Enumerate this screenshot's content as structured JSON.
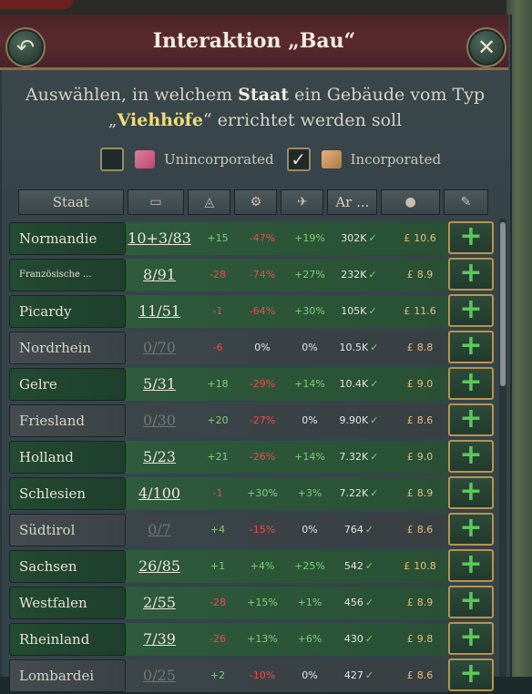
{
  "dialog": {
    "title": "Interaktion „Bau“",
    "back_icon": "undo-arrow-icon",
    "close_icon": "close-x-icon",
    "prompt_prefix": "Auswählen, in welchem ",
    "prompt_bold": "Staat",
    "prompt_middle": " ein Gebäude vom Typ",
    "prompt_open_quote": "„",
    "prompt_building": "Viehhöfe",
    "prompt_suffix": "“ errichtet werden soll"
  },
  "filters": {
    "unincorporated": {
      "label": "Unincorporated",
      "checked": false
    },
    "incorporated": {
      "label": "Incorporated",
      "checked": true
    }
  },
  "columns": {
    "state": "Staat",
    "buildings_icon": "building-levels-icon",
    "construction_icon": "construction-icon",
    "infrastructure_icon": "infrastructure-icon",
    "airport_icon": "airplane-icon",
    "arable": "Ar ...",
    "cost_icon": "bomb-cost-icon",
    "action_icon": "edit-icon"
  },
  "colors": {
    "positive": "#7fd07a",
    "negative": "#f04a4a",
    "accent_border": "#b8944c",
    "highlight": "#f0dd78"
  },
  "rows": [
    {
      "name": "Normandie",
      "levels": "10+3/83",
      "c1": "+15",
      "c2": "-47%",
      "c3": "+19%",
      "c4": "302K",
      "c5": "10.6",
      "dim": false
    },
    {
      "name": "Französische ...",
      "levels": "8/91",
      "c1": "-28",
      "c2": "-74%",
      "c3": "+27%",
      "c4": "232K",
      "c5": "8.9",
      "dim": false
    },
    {
      "name": "Picardy",
      "levels": "11/51",
      "c1": "-1",
      "c2": "-64%",
      "c3": "+30%",
      "c4": "105K",
      "c5": "11.6",
      "dim": false
    },
    {
      "name": "Nordrhein",
      "levels": "0/70",
      "c1": "-6",
      "c2": "0%",
      "c3": "0%",
      "c4": "10.5K",
      "c5": "8.8",
      "dim": true
    },
    {
      "name": "Gelre",
      "levels": "5/31",
      "c1": "+18",
      "c2": "-29%",
      "c3": "+14%",
      "c4": "10.4K",
      "c5": "9.0",
      "dim": false
    },
    {
      "name": "Friesland",
      "levels": "0/30",
      "c1": "+20",
      "c2": "-27%",
      "c3": "0%",
      "c4": "9.90K",
      "c5": "8.6",
      "dim": true
    },
    {
      "name": "Holland",
      "levels": "5/23",
      "c1": "+21",
      "c2": "-26%",
      "c3": "+14%",
      "c4": "7.32K",
      "c5": "9.0",
      "dim": false
    },
    {
      "name": "Schlesien",
      "levels": "4/100",
      "c1": "-1",
      "c2": "+30%",
      "c3": "+3%",
      "c4": "7.22K",
      "c5": "8.9",
      "dim": false
    },
    {
      "name": "Südtirol",
      "levels": "0/7",
      "c1": "+4",
      "c2": "-15%",
      "c3": "0%",
      "c4": "764",
      "c5": "8.6",
      "dim": true
    },
    {
      "name": "Sachsen",
      "levels": "26/85",
      "c1": "+1",
      "c2": "+4%",
      "c3": "+25%",
      "c4": "542",
      "c5": "10.8",
      "dim": false
    },
    {
      "name": "Westfalen",
      "levels": "2/55",
      "c1": "-28",
      "c2": "+15%",
      "c3": "+1%",
      "c4": "456",
      "c5": "8.9",
      "dim": false
    },
    {
      "name": "Rheinland",
      "levels": "7/39",
      "c1": "-26",
      "c2": "+13%",
      "c3": "+6%",
      "c4": "430",
      "c5": "9.8",
      "dim": false
    },
    {
      "name": "Lombardei",
      "levels": "0/25",
      "c1": "+2",
      "c2": "-10%",
      "c3": "0%",
      "c4": "427",
      "c5": "8.6",
      "dim": true
    }
  ],
  "row_check_glyph": "✓",
  "pound_glyph": "£",
  "plus_glyph": "+"
}
